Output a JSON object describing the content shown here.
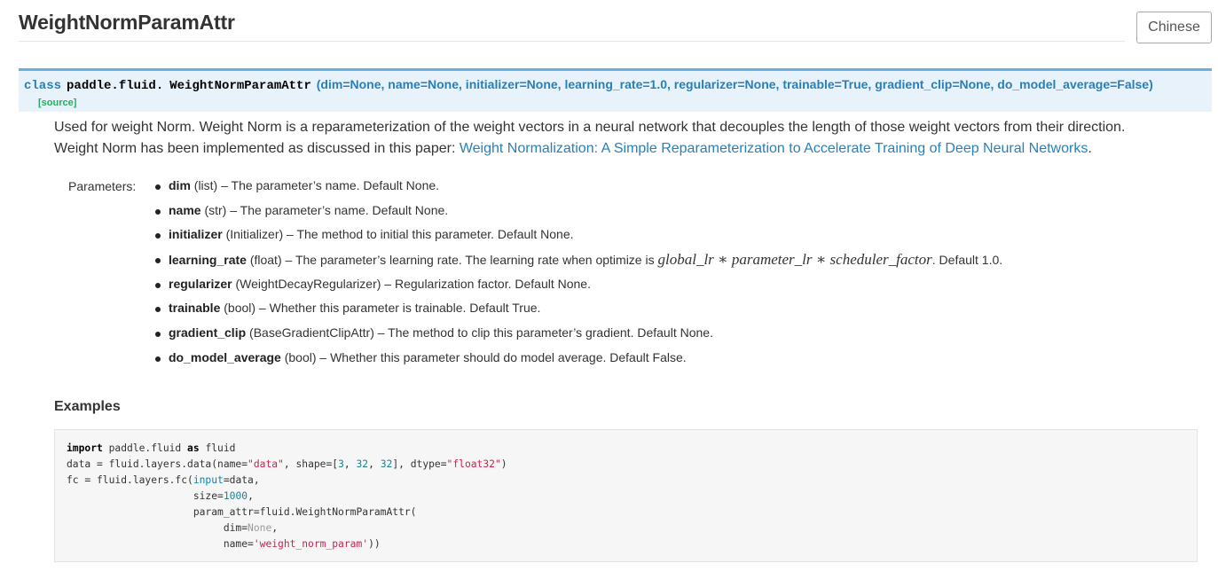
{
  "page": {
    "title": "WeightNormParamAttr",
    "lang_button": "Chinese"
  },
  "signature": {
    "keyword": "class",
    "prefix": "paddle.fluid.",
    "name": "WeightNormParamAttr",
    "params": "(dim=None, name=None, initializer=None, learning_rate=1.0, regularizer=None, trainable=True, gradient_clip=None, do_model_average=False)",
    "source": "[source]"
  },
  "description": {
    "line1": "Used for weight Norm. Weight Norm is a reparameterization of the weight vectors in a neural network that decouples the length of those weight vectors from their direction.",
    "line2_prefix": "Weight Norm has been implemented as discussed in this paper: ",
    "link": "Weight Normalization: A Simple Reparameterization to Accelerate Training of Deep Neural Networks",
    "line2_suffix": "."
  },
  "parameters": {
    "label": "Parameters:",
    "items": [
      {
        "name": "dim",
        "type": " (list)",
        "desc": " – The parameter’s name. Default None."
      },
      {
        "name": "name",
        "type": " (str)",
        "desc": " – The parameter’s name. Default None."
      },
      {
        "name": "initializer",
        "type": " (Initializer)",
        "desc": " – The method to initial this parameter. Default None."
      },
      {
        "name": "learning_rate",
        "type": " (float)",
        "desc": " – The parameter’s learning rate. The learning rate when optimize is ",
        "math": "global_lr ∗ parameter_lr ∗ scheduler_factor",
        "desc2": ". Default 1.0."
      },
      {
        "name": "regularizer",
        "type": " (WeightDecayRegularizer)",
        "desc": " – Regularization factor. Default None."
      },
      {
        "name": "trainable",
        "type": " (bool)",
        "desc": " – Whether this parameter is trainable. Default True."
      },
      {
        "name": "gradient_clip",
        "type": " (BaseGradientClipAttr)",
        "desc": " – The method to clip this parameter’s gradient. Default None."
      },
      {
        "name": "do_model_average",
        "type": " (bool)",
        "desc": " – Whether this parameter should do model average. Default False."
      }
    ]
  },
  "examples": {
    "title": "Examples",
    "code_lines": [
      "import paddle.fluid as fluid",
      "data = fluid.layers.data(name=\"data\", shape=[3, 32, 32], dtype=\"float32\")",
      "fc = fluid.layers.fc(input=data,",
      "                     size=1000,",
      "                     param_attr=fluid.WeightNormParamAttr(",
      "                          dim=None,",
      "                          name='weight_norm_param'))"
    ]
  },
  "colors": {
    "signature_bg": "#e7f2fa",
    "signature_border": "#6ab0de",
    "link": "#2980b9",
    "source": "#27ae60",
    "code_bg": "#f6f6f6"
  }
}
